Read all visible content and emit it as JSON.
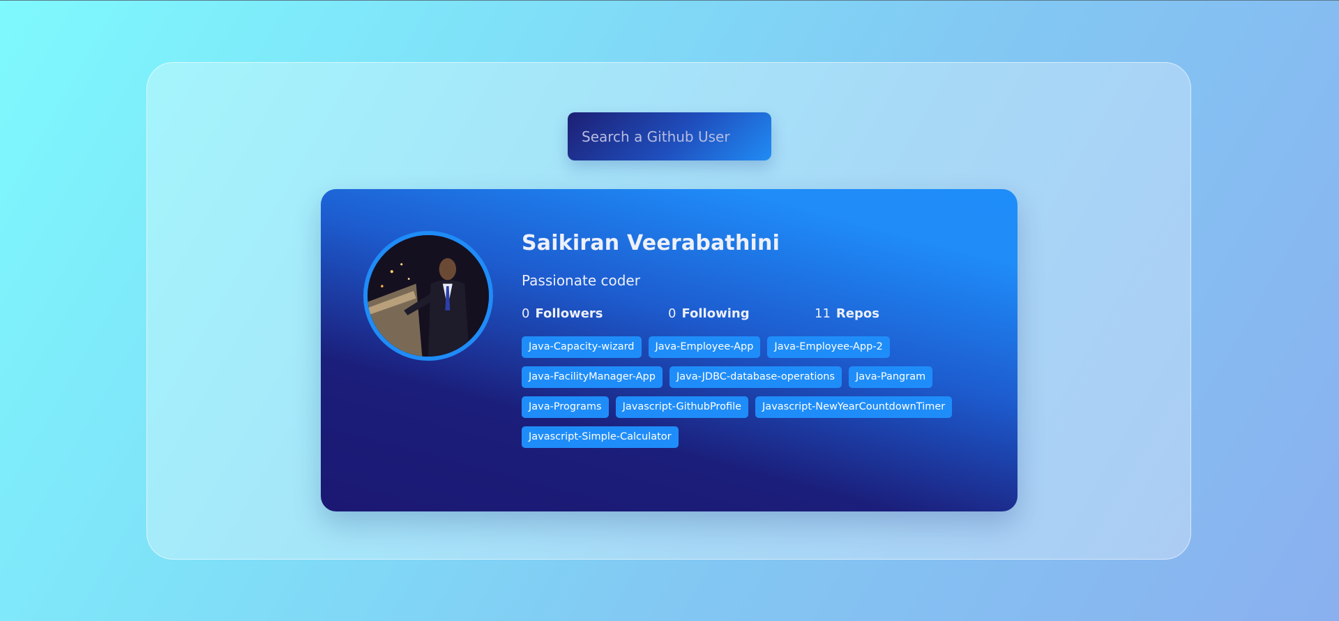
{
  "search": {
    "placeholder": "Search a Github User"
  },
  "profile": {
    "name": "Saikiran Veerabathini",
    "bio": "Passionate coder",
    "avatar_alt": "avatar",
    "stats": [
      {
        "count": "0",
        "label": "Followers"
      },
      {
        "count": "0",
        "label": "Following"
      },
      {
        "count": "11",
        "label": "Repos"
      }
    ],
    "repos": [
      "Java-Capacity-wizard",
      "Java-Employee-App",
      "Java-Employee-App-2",
      "Java-FacilityManager-App",
      "Java-JDBC-database-operations",
      "Java-Pangram",
      "Java-Programs",
      "Javascript-GithubProfile",
      "Javascript-NewYearCountdownTimer",
      "Javascript-Simple-Calculator"
    ]
  },
  "colors": {
    "accent": "#1f8df9",
    "card_dark": "#1b1873",
    "text": "#eef0fa"
  }
}
